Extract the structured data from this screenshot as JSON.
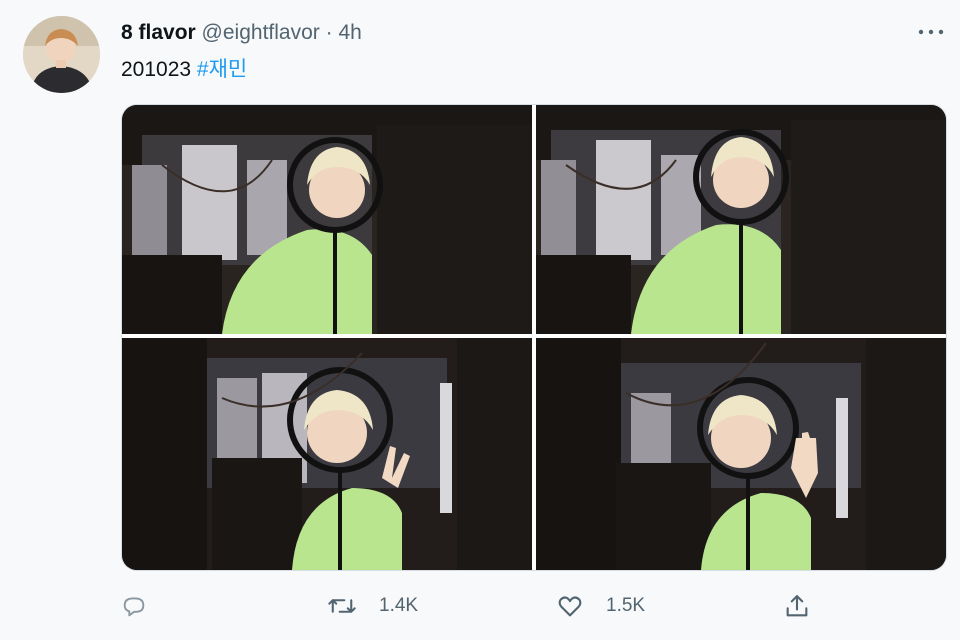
{
  "tweet": {
    "avatar_icon": "profile-avatar",
    "display_name": "8 flavor",
    "handle": "@eightflavor",
    "separator": "·",
    "timestamp": "4h",
    "text": "201023",
    "hashtag": "#재민",
    "more_icon": "more-options-icon",
    "photos": [
      {
        "label": "photo 1"
      },
      {
        "label": "photo 2"
      },
      {
        "label": "photo 3"
      },
      {
        "label": "photo 4"
      }
    ],
    "actions": {
      "reply": {
        "icon": "reply-icon",
        "count": ""
      },
      "retweet": {
        "icon": "retweet-icon",
        "count": "1.4K"
      },
      "like": {
        "icon": "heart-icon",
        "count": "1.5K"
      },
      "share": {
        "icon": "share-icon",
        "count": ""
      }
    }
  },
  "colors": {
    "background": "#f7f9fa",
    "text": "#0f1419",
    "secondary": "#536471",
    "link": "#1d9bf0",
    "hoodie": "#b9e58e"
  }
}
